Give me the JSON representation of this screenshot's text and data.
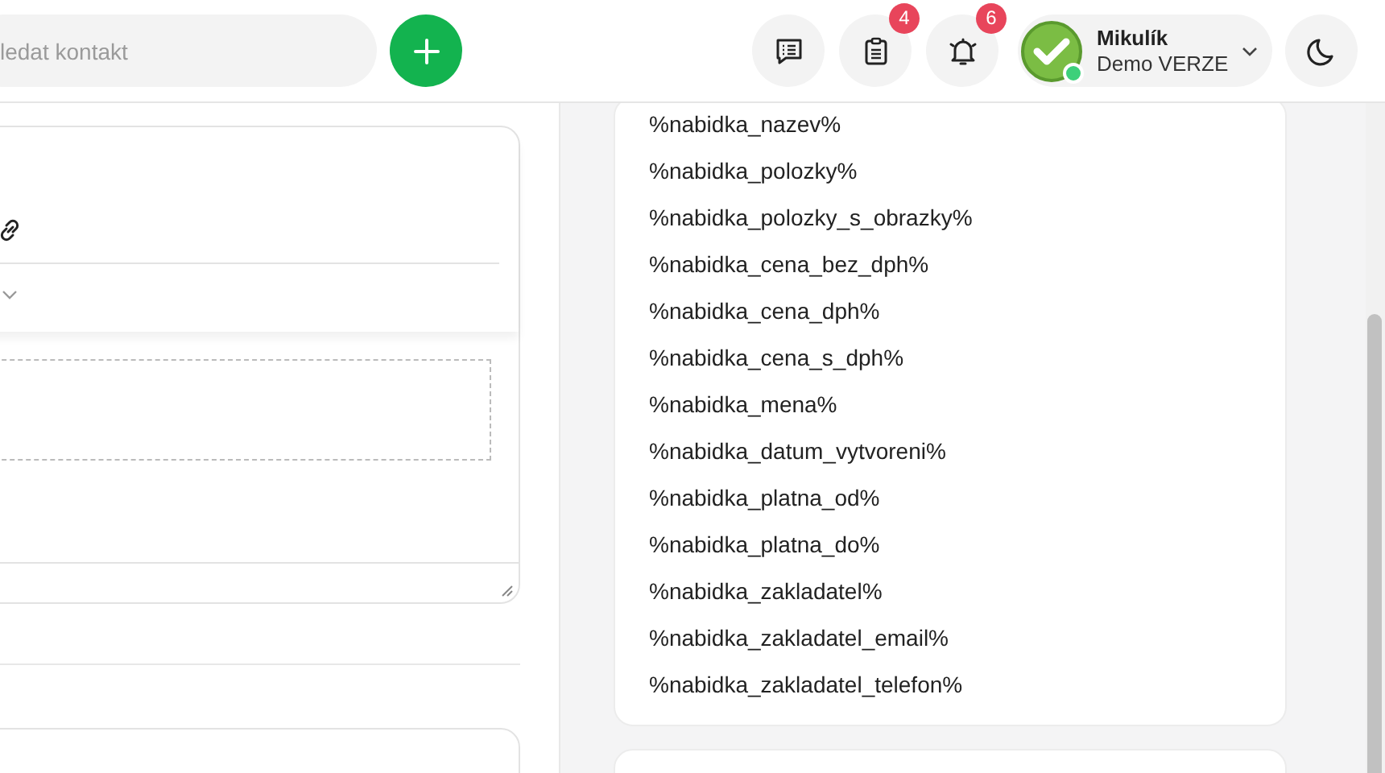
{
  "search": {
    "placeholder": "ledat kontakt"
  },
  "header_buttons": [
    {
      "kind": "messages"
    },
    {
      "kind": "tasks",
      "badge": "4"
    },
    {
      "kind": "notifications",
      "badge": "6"
    }
  ],
  "user": {
    "name": "Mikulík",
    "subtitle": "Demo VERZE",
    "online": true
  },
  "placeholders": [
    "%nabidka_nazev%",
    "%nabidka_polozky%",
    "%nabidka_polozky_s_obrazky%",
    "%nabidka_cena_bez_dph%",
    "%nabidka_cena_dph%",
    "%nabidka_cena_s_dph%",
    "%nabidka_mena%",
    "%nabidka_datum_vytvoreni%",
    "%nabidka_platna_od%",
    "%nabidka_platna_do%",
    "%nabidka_zakladatel%",
    "%nabidka_zakladatel_email%",
    "%nabidka_zakladatel_telefon%"
  ]
}
